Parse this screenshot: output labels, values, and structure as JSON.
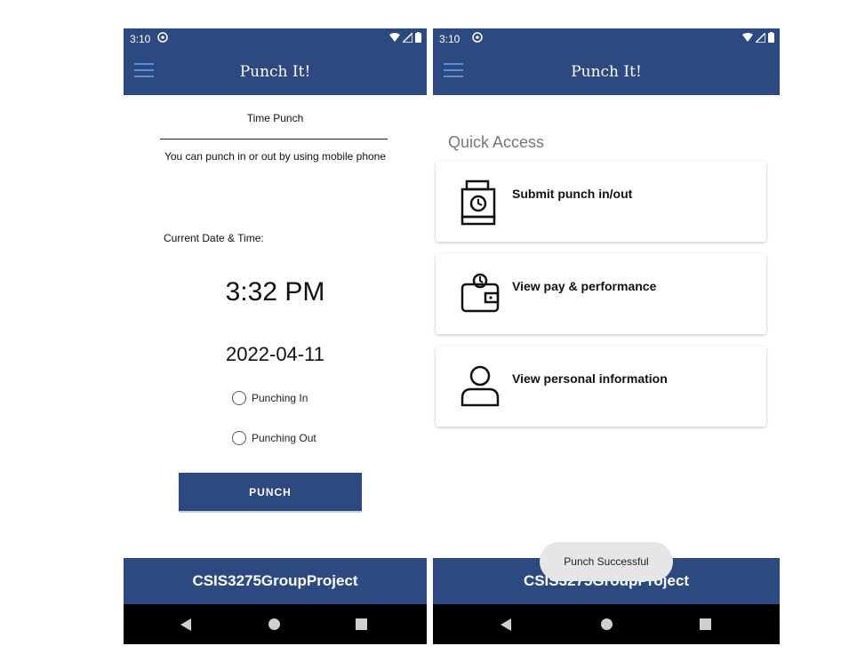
{
  "left_screen": {
    "status": {
      "time": "3:10"
    },
    "app_bar": {
      "title": "Punch It!"
    },
    "section_title": "Time Punch",
    "subtitle": "You can punch in or out by using mobile phone",
    "current_label": "Current Date & Time:",
    "time_value": "3:32 PM",
    "date_value": "2022-04-11",
    "radio_options": [
      "Punching In",
      "Punching Out"
    ],
    "punch_button": "PUNCH",
    "bottom_band": "CSIS3275GroupProject"
  },
  "right_screen": {
    "status": {
      "time": "3:10"
    },
    "app_bar": {
      "title": "Punch It!"
    },
    "quick_access_title": "Quick Access",
    "cards": [
      {
        "label": "Submit punch in/out",
        "icon": "punch-clock-icon"
      },
      {
        "label": "View pay & performance",
        "icon": "wallet-icon"
      },
      {
        "label": "View personal information",
        "icon": "person-icon"
      }
    ],
    "bottom_band": "CSIS3275GroupProject",
    "toast": "Punch Successful"
  },
  "colors": {
    "primary": "#2d4a80",
    "menu_icon": "#5c8fd6",
    "nav_bar": "#000000",
    "toast_bg": "#e6e6e6"
  }
}
